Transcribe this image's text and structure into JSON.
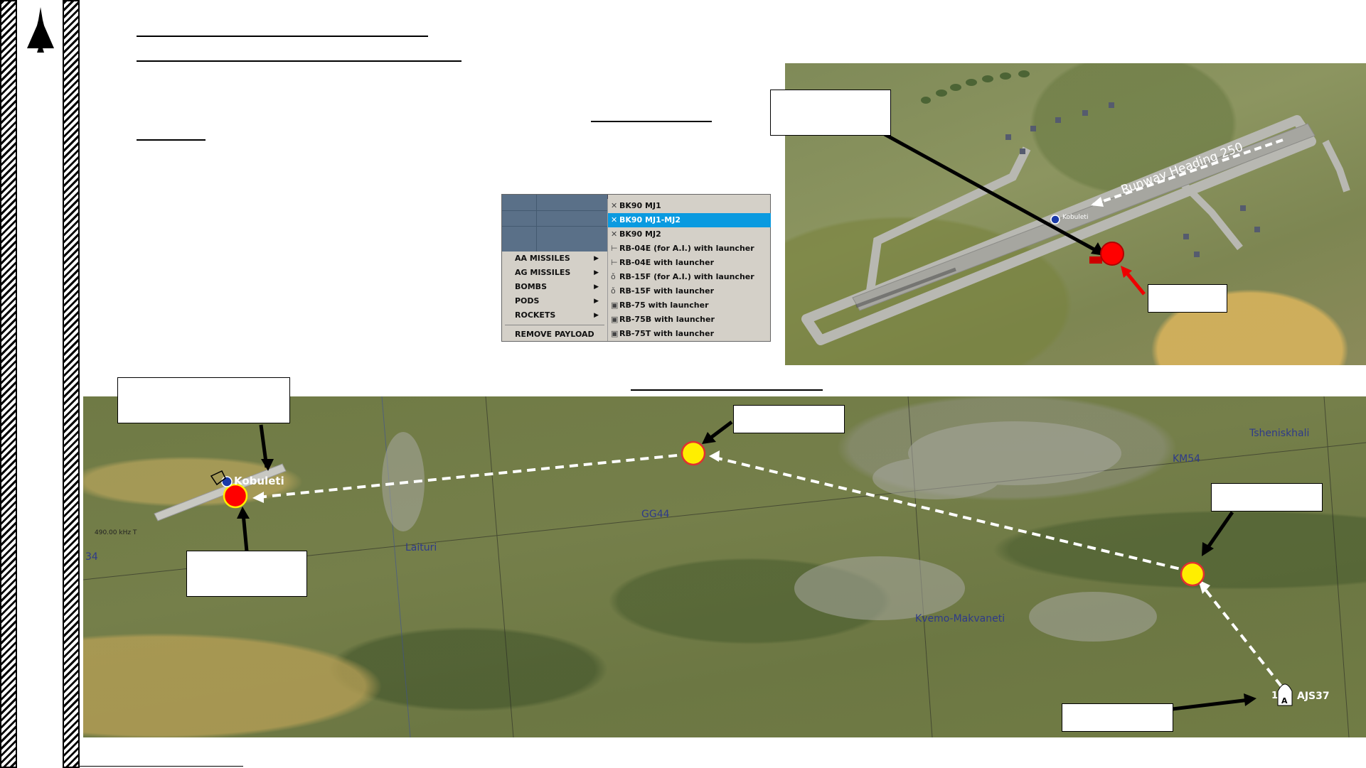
{
  "logo": {
    "name": "AJS37 Viggen logo"
  },
  "menu": {
    "categories": [
      {
        "label": "AA MISSILES"
      },
      {
        "label": "AG MISSILES"
      },
      {
        "label": "BOMBS"
      },
      {
        "label": "PODS"
      },
      {
        "label": "ROCKETS"
      }
    ],
    "remove_label": "REMOVE PAYLOAD",
    "items": [
      {
        "label": "BK90 MJ1",
        "selected": false
      },
      {
        "label": "BK90 MJ1-MJ2",
        "selected": true
      },
      {
        "label": "BK90 MJ2",
        "selected": false
      },
      {
        "label": "RB-04E (for A.I.) with launcher",
        "selected": false
      },
      {
        "label": "RB-04E with launcher",
        "selected": false
      },
      {
        "label": "RB-15F (for A.I.) with launcher",
        "selected": false
      },
      {
        "label": "RB-15F with launcher",
        "selected": false
      },
      {
        "label": "RB-75 with launcher",
        "selected": false
      },
      {
        "label": "RB-75B with launcher",
        "selected": false
      },
      {
        "label": "RB-75T with launcher",
        "selected": false
      }
    ],
    "selection_color": "#0a9ae0"
  },
  "airfield_map": {
    "runway_label": "Runway Heading 250",
    "airfield_name": "Kobuleti",
    "marker_color": "#ff0000"
  },
  "route_map": {
    "airfield_name": "Kobuleti",
    "frequency": "490.00 kHz T",
    "grid_labels": [
      "GG44",
      "KM54",
      "34"
    ],
    "towns": [
      "Laituri",
      "Kvemo-Makvaneti",
      "Tsheniskhali"
    ],
    "aircraft_label": "AJS37",
    "aircraft_group": "1",
    "aircraft_icon_letter": "A",
    "waypoint_color": "#ffee00",
    "target_color": "#ff0000"
  }
}
